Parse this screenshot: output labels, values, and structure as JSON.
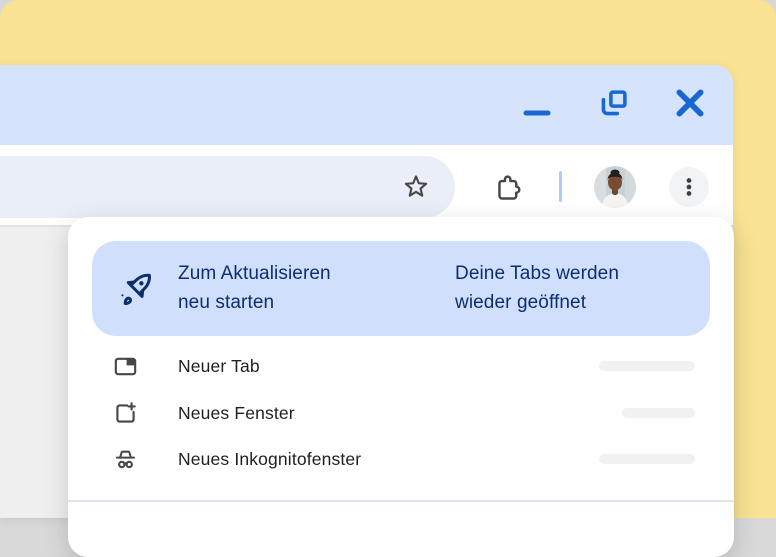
{
  "colors": {
    "background_yellow": "#F9E292",
    "titlebar_blue": "#D5E3FC",
    "banner_blue": "#D0E0FC",
    "accent_blue": "#1967D2",
    "navy_text": "#0D2E6E",
    "menu_text": "#1F1F1F",
    "icon_gray": "#474747"
  },
  "window": {
    "controls": {
      "minimize_icon": "minimize-icon",
      "restore_icon": "restore-icon",
      "close_icon": "close-icon"
    }
  },
  "toolbar": {
    "address_bar_value": "",
    "bookmark_icon": "bookmark-star-icon",
    "extensions_icon": "extensions-puzzle-icon",
    "profile_icon": "profile-avatar",
    "more_icon": "more-vert-icon"
  },
  "menu": {
    "update_banner": {
      "icon": "rocket-icon",
      "title_line1": "Zum Aktualisieren",
      "title_line2": "neu starten",
      "subtitle_line1": "Deine Tabs werden",
      "subtitle_line2": "wieder geöffnet"
    },
    "items": [
      {
        "icon": "new-tab-icon",
        "label": "Neuer Tab"
      },
      {
        "icon": "new-window-icon",
        "label": "Neues Fenster"
      },
      {
        "icon": "incognito-icon",
        "label": "Neues Inkognitofenster"
      }
    ]
  }
}
